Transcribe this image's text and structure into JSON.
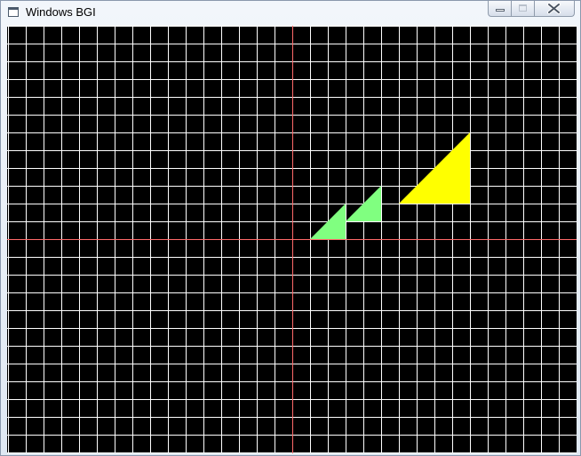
{
  "window": {
    "title": "Windows BGI",
    "icon": "window-app-icon",
    "controls": [
      "minimize-icon",
      "maximize-icon",
      "close-icon"
    ]
  },
  "canvas": {
    "background_color": "#000000",
    "grid_color": "#ffffff",
    "axis_color": "#ff6a6a",
    "grid_spacing_units": 1,
    "triangles": [
      {
        "name": "small-green-triangle",
        "fill": "#80ff80",
        "vertices": [
          [
            1,
            0
          ],
          [
            3,
            0
          ],
          [
            3,
            2
          ]
        ]
      },
      {
        "name": "translated-green-triangle",
        "fill": "#80ff80",
        "vertices": [
          [
            3,
            1
          ],
          [
            5,
            1
          ],
          [
            5,
            3
          ]
        ]
      },
      {
        "name": "scaled-yellow-triangle",
        "fill": "#ffff00",
        "vertices": [
          [
            6,
            2
          ],
          [
            10,
            2
          ],
          [
            10,
            6
          ]
        ]
      }
    ]
  }
}
